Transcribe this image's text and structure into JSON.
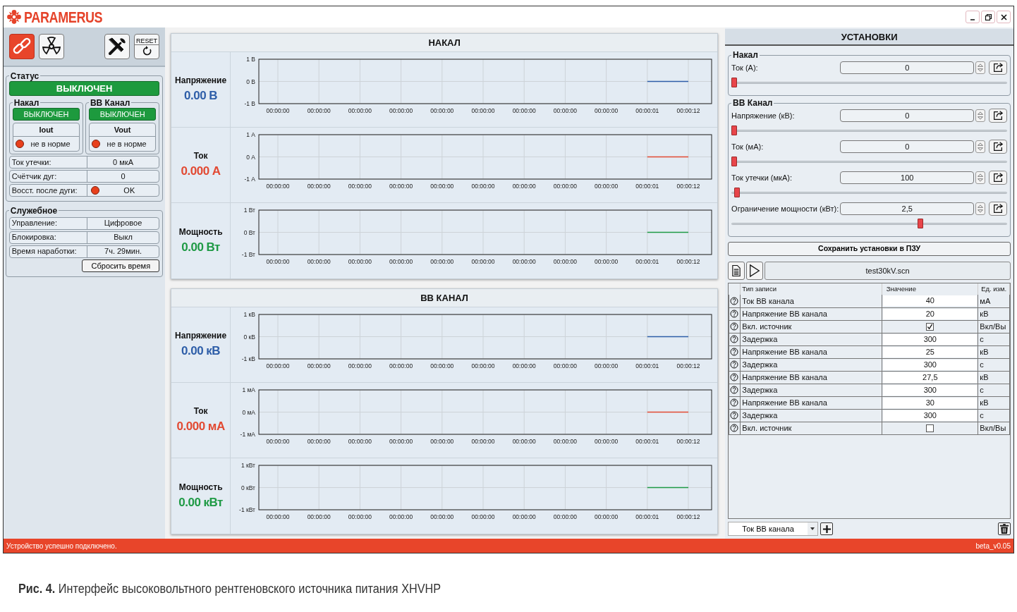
{
  "app": {
    "logo": "PARAMERUS"
  },
  "toolbar": {
    "modes": [
      {
        "kind": "link",
        "selected": true
      },
      {
        "kind": "radiation",
        "selected": false
      }
    ],
    "reset_label": "RESET"
  },
  "status": {
    "title": "Статус",
    "state": "ВЫКЛЮЧЕН",
    "channels": [
      {
        "title": "Накал",
        "state": "ВЫКЛЮЧЕН",
        "signal": "Iout",
        "color": "#e8401c",
        "reading": "не в норме"
      },
      {
        "title": "ВВ Канал",
        "state": "ВЫКЛЮЧЕН",
        "signal": "Vout",
        "color": "#e8401c",
        "reading": "не в норме"
      }
    ],
    "rows": [
      {
        "label": "Ток утечки:",
        "value": "0 мкА"
      },
      {
        "label": "Счётчик дуг:",
        "value": "0"
      },
      {
        "label": "Восст. после дуги:",
        "value": "OK",
        "color": "#e8401c"
      }
    ]
  },
  "service": {
    "title": "Служебное",
    "rows": [
      {
        "label": "Управление:",
        "value": "Цифровое"
      },
      {
        "label": "Блокировка:",
        "value": "Выкл"
      },
      {
        "label": "Время наработки:",
        "value": "7ч. 29мин."
      }
    ],
    "button": "Сбросить время"
  },
  "panels": [
    {
      "title": "НАКАЛ",
      "rows": [
        {
          "name": "Напряжение",
          "reading": "0.00 В",
          "chart_data": {
            "type": "line",
            "grid": true,
            "categories": [
              "00:00:00",
              "00:00:00",
              "00:00:00",
              "00:00:00",
              "00:00:00",
              "00:00:00",
              "00:00:00",
              "00:00:00",
              "00:00:00",
              "00:00:01",
              "00:00:12"
            ],
            "ylim": [
              -1,
              1
            ],
            "yticks": [
              {
                "value": 1,
                "label": "1 В"
              },
              {
                "value": 0,
                "label": "0 В"
              },
              {
                "value": -1,
                "label": "-1 В"
              }
            ],
            "series": [
              {
                "color": "#2e5ea8",
                "values": [
                  null,
                  null,
                  null,
                  null,
                  null,
                  null,
                  null,
                  null,
                  null,
                  0,
                  0
                ]
              }
            ]
          }
        },
        {
          "name": "Ток",
          "reading": "0.000 А",
          "chart_data": {
            "type": "line",
            "grid": true,
            "categories": [
              "00:00:00",
              "00:00:00",
              "00:00:00",
              "00:00:00",
              "00:00:00",
              "00:00:00",
              "00:00:00",
              "00:00:00",
              "00:00:00",
              "00:00:01",
              "00:00:12"
            ],
            "ylim": [
              -1,
              1
            ],
            "yticks": [
              {
                "value": 1,
                "label": "1 А"
              },
              {
                "value": 0,
                "label": "0 А"
              },
              {
                "value": -1,
                "label": "-1 А"
              }
            ],
            "series": [
              {
                "color": "#e24a33",
                "values": [
                  null,
                  null,
                  null,
                  null,
                  null,
                  null,
                  null,
                  null,
                  null,
                  0,
                  0
                ]
              }
            ]
          }
        },
        {
          "name": "Мощность",
          "reading": "0.00 Вт",
          "chart_data": {
            "type": "line",
            "grid": true,
            "categories": [
              "00:00:00",
              "00:00:00",
              "00:00:00",
              "00:00:00",
              "00:00:00",
              "00:00:00",
              "00:00:00",
              "00:00:00",
              "00:00:00",
              "00:00:01",
              "00:00:12"
            ],
            "ylim": [
              -1,
              1
            ],
            "yticks": [
              {
                "value": 1,
                "label": "1 Вт"
              },
              {
                "value": 0,
                "label": "0 Вт"
              },
              {
                "value": -1,
                "label": "-1 Вт"
              }
            ],
            "series": [
              {
                "color": "#1f9a45",
                "values": [
                  null,
                  null,
                  null,
                  null,
                  null,
                  null,
                  null,
                  null,
                  null,
                  0,
                  0
                ]
              }
            ]
          }
        }
      ]
    },
    {
      "title": "ВВ КАНАЛ",
      "rows": [
        {
          "name": "Напряжение",
          "reading": "0.00 кВ",
          "chart_data": {
            "type": "line",
            "grid": true,
            "categories": [
              "00:00:00",
              "00:00:00",
              "00:00:00",
              "00:00:00",
              "00:00:00",
              "00:00:00",
              "00:00:00",
              "00:00:00",
              "00:00:00",
              "00:00:01",
              "00:00:12"
            ],
            "ylim": [
              -1,
              1
            ],
            "yticks": [
              {
                "value": 1,
                "label": "1 кВ"
              },
              {
                "value": 0,
                "label": "0 кВ"
              },
              {
                "value": -1,
                "label": "-1 кВ"
              }
            ],
            "series": [
              {
                "color": "#2e5ea8",
                "values": [
                  null,
                  null,
                  null,
                  null,
                  null,
                  null,
                  null,
                  null,
                  null,
                  0,
                  0
                ]
              }
            ]
          }
        },
        {
          "name": "Ток",
          "reading": "0.000 мА",
          "chart_data": {
            "type": "line",
            "grid": true,
            "categories": [
              "00:00:00",
              "00:00:00",
              "00:00:00",
              "00:00:00",
              "00:00:00",
              "00:00:00",
              "00:00:00",
              "00:00:00",
              "00:00:00",
              "00:00:01",
              "00:00:12"
            ],
            "ylim": [
              -1,
              1
            ],
            "yticks": [
              {
                "value": 1,
                "label": "1 мА"
              },
              {
                "value": 0,
                "label": "0 мА"
              },
              {
                "value": -1,
                "label": "-1 мА"
              }
            ],
            "series": [
              {
                "color": "#e24a33",
                "values": [
                  null,
                  null,
                  null,
                  null,
                  null,
                  null,
                  null,
                  null,
                  null,
                  0,
                  0
                ]
              }
            ]
          }
        },
        {
          "name": "Мощность",
          "reading": "0.00 кВт",
          "chart_data": {
            "type": "line",
            "grid": true,
            "categories": [
              "00:00:00",
              "00:00:00",
              "00:00:00",
              "00:00:00",
              "00:00:00",
              "00:00:00",
              "00:00:00",
              "00:00:00",
              "00:00:00",
              "00:00:01",
              "00:00:12"
            ],
            "ylim": [
              -1,
              1
            ],
            "yticks": [
              {
                "value": 1,
                "label": "1 кВт"
              },
              {
                "value": 0,
                "label": "0 кВт"
              },
              {
                "value": -1,
                "label": "-1 кВт"
              }
            ],
            "series": [
              {
                "color": "#1f9a45",
                "values": [
                  null,
                  null,
                  null,
                  null,
                  null,
                  null,
                  null,
                  null,
                  null,
                  0,
                  0
                ]
              }
            ]
          }
        }
      ]
    }
  ],
  "settings": {
    "title": "УСТАНОВКИ",
    "groups": [
      {
        "title": "Накал",
        "fields": [
          {
            "label": "Ток (А):",
            "value": "0",
            "level": 0
          }
        ]
      },
      {
        "title": "ВВ Канал",
        "fields": [
          {
            "label": "Напряжение (кВ):",
            "value": "0",
            "level": 0
          },
          {
            "label": "Ток (мА):",
            "value": "0",
            "level": 0
          },
          {
            "label": "Ток утечки (мкА):",
            "value": "100",
            "level": 0.01
          },
          {
            "label": "Ограничение мощности (кВт):",
            "value": "2,5",
            "level": 0.69
          }
        ]
      }
    ],
    "save_button": "Сохранить установки в ПЗУ",
    "scenario": {
      "file": "test30kV.scn",
      "columns": [
        "Тип записи",
        "Значение",
        "Ед. изм."
      ],
      "rows": [
        {
          "kind": "number",
          "type": "Ток ВВ канала",
          "value": "40",
          "unit": "мА"
        },
        {
          "kind": "number",
          "type": "Напряжение ВВ канала",
          "value": "20",
          "unit": "кВ"
        },
        {
          "kind": "checkbox",
          "type": "Вкл. источник",
          "checked": true,
          "unit": "Вкл/Вы"
        },
        {
          "kind": "number",
          "type": "Задержка",
          "value": "300",
          "unit": "с"
        },
        {
          "kind": "number",
          "type": "Напряжение ВВ канала",
          "value": "25",
          "unit": "кВ"
        },
        {
          "kind": "number",
          "type": "Задержка",
          "value": "300",
          "unit": "с"
        },
        {
          "kind": "number",
          "type": "Напряжение ВВ канала",
          "value": "27,5",
          "unit": "кВ"
        },
        {
          "kind": "number",
          "type": "Задержка",
          "value": "300",
          "unit": "с"
        },
        {
          "kind": "number",
          "type": "Напряжение ВВ канала",
          "value": "30",
          "unit": "кВ"
        },
        {
          "kind": "number",
          "type": "Задержка",
          "value": "300",
          "unit": "с"
        },
        {
          "kind": "checkbox",
          "type": "Вкл. источник",
          "checked": false,
          "unit": "Вкл/Вы"
        }
      ],
      "record_type": "Ток ВВ канала"
    }
  },
  "status_bar": {
    "message": "Устройство успешно подключено.",
    "version": "beta_v0.05"
  },
  "caption": "**Рис. 4.** Интерфейс высоковольтного рентгеновского источника питания XHVHP"
}
